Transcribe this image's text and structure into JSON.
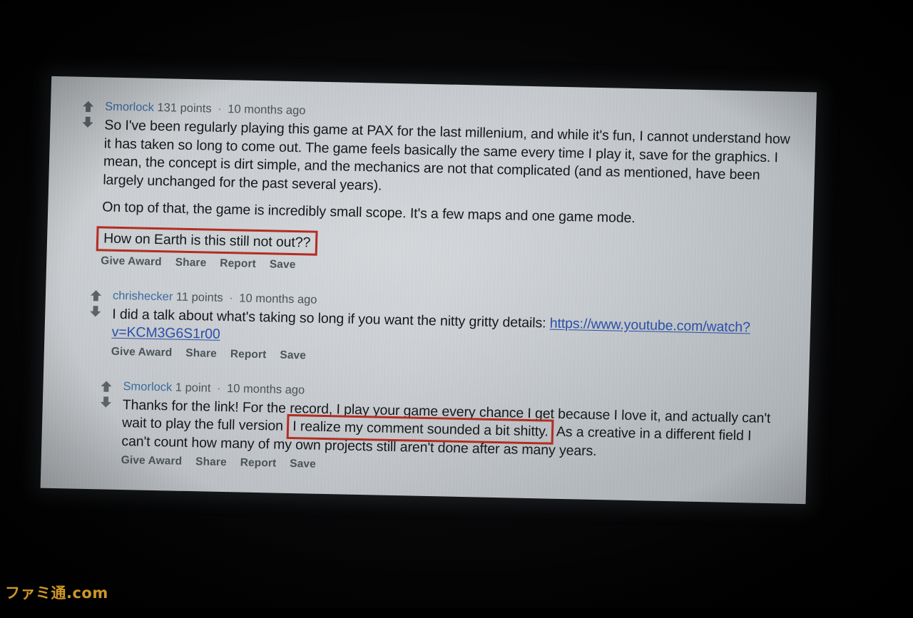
{
  "scene": {
    "type": "photo-of-projected-screen",
    "watermark": "ファミ通.com",
    "screen_bg_color": "#c7cbcf",
    "room_bg_color": "#000000"
  },
  "annotations": {
    "highlight_color": "#b32d22",
    "boxes": [
      {
        "id": "box-1",
        "text": "How on Earth is this still not out??"
      },
      {
        "id": "box-2",
        "text": "I realize my comment sounded a bit shitty."
      }
    ]
  },
  "thread": {
    "comments": [
      {
        "id": "comment-1",
        "depth": 0,
        "author": "Smorlock",
        "score": "131 points",
        "separator": "·",
        "age": "10 months ago",
        "paragraphs": [
          "So I've been regularly playing this game at PAX for the last millenium, and while it's fun, I cannot understand how it has taken so long to come out. The game feels basically the same every time I play it, save for the graphics. I mean, the concept is dirt simple, and the mechanics are not that complicated (and as mentioned, have been largely unchanged for the past several years).",
          "On top of that, the game is incredibly small scope. It's a few maps and one game mode."
        ],
        "highlighted_line": "How on Earth is this still not out??",
        "actions": [
          "Give Award",
          "Share",
          "Report",
          "Save"
        ],
        "upvote_icon": "arrow-up-icon",
        "downvote_icon": "arrow-down-icon"
      },
      {
        "id": "comment-2",
        "depth": 1,
        "author": "chrishecker",
        "score": "11 points",
        "separator": "·",
        "age": "10 months ago",
        "text_before_link": "I did a talk about what's taking so long if you want the nitty gritty details: ",
        "link_text": "https://www.youtube.com/watch?v=KCM3G6S1r00",
        "actions": [
          "Give Award",
          "Share",
          "Report",
          "Save"
        ],
        "upvote_icon": "arrow-up-icon",
        "downvote_icon": "arrow-down-icon"
      },
      {
        "id": "comment-3",
        "depth": 2,
        "author": "Smorlock",
        "score": "1 point",
        "separator": "·",
        "age": "10 months ago",
        "text_part_1": "Thanks for the link! For the record, I play your game every chance I get because I love it, and actually can't wait to play the full version",
        "text_highlighted": "I realize my comment sounded a bit shitty.",
        "text_part_2": "As a creative in a different field I can't count how many of my own projects still aren't done after as many years.",
        "actions": [
          "Give Award",
          "Share",
          "Report",
          "Save"
        ],
        "upvote_icon": "arrow-up-icon",
        "downvote_icon": "arrow-down-icon"
      }
    ]
  }
}
